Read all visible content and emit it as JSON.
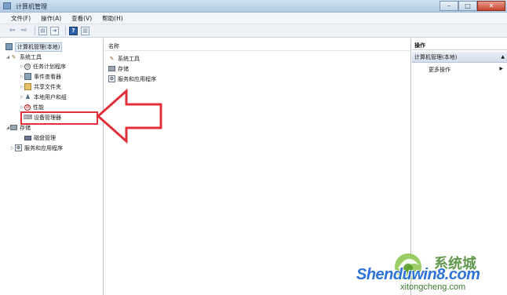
{
  "window": {
    "title": "计算机管理"
  },
  "menu": [
    "文件(F)",
    "操作(A)",
    "查看(V)",
    "帮助(H)"
  ],
  "tree": {
    "root": "计算机管理(本地)",
    "system_tools": "系统工具",
    "children": [
      {
        "label": "任务计划程序",
        "icon": "clock-icon"
      },
      {
        "label": "事件查看器",
        "icon": "event-log-icon"
      },
      {
        "label": "共享文件夹",
        "icon": "shared-folder-icon"
      },
      {
        "label": "本地用户和组",
        "icon": "users-icon"
      },
      {
        "label": "性能",
        "icon": "performance-icon"
      },
      {
        "label": "设备管理器",
        "icon": "device-manager-icon"
      }
    ],
    "storage": "存储",
    "disk_management": "磁盘管理",
    "services": "服务和应用程序"
  },
  "center": {
    "column_header": "名称",
    "items": [
      "系统工具",
      "存储",
      "服务和应用程序"
    ]
  },
  "actions": {
    "header": "操作",
    "group": "计算机管理(本地)",
    "more": "更多操作"
  },
  "watermark": {
    "cn": "系统城",
    "en": "Shenduwin8.com",
    "site": "xitongcheng.com"
  },
  "colors": {
    "highlight": "#e0313a",
    "accent": "#2e73d6",
    "watermark_green": "#4f8d3a"
  }
}
